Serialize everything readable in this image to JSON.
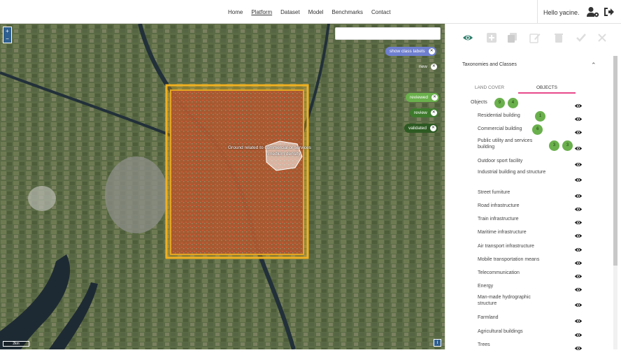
{
  "nav": {
    "links": [
      "Home",
      "Platform",
      "Dataset",
      "Model",
      "Benchmarks",
      "Contact"
    ],
    "active": "Platform",
    "greeting": "Hello yacine."
  },
  "map": {
    "zoom_in": "+",
    "zoom_out": "−",
    "search_placeholder": "",
    "filters": [
      {
        "label": "show class labels",
        "color": "#6f7fcf"
      },
      {
        "label": "new",
        "color": "#555555"
      },
      {
        "label": "reviewed",
        "color": "#6ab04c"
      },
      {
        "label": "review",
        "color": "#3d7a2c"
      },
      {
        "label": "validated",
        "color": "#2d5a22"
      }
    ],
    "annotation_line1": "Ground related to commercial or services",
    "annotation_line2": "- medium density",
    "scale": "2km",
    "info": "i"
  },
  "panel": {
    "section_title": "Taxonomies and Classes",
    "tabs": [
      "LAND COVER",
      "OBJECTS"
    ],
    "active_tab": "OBJECTS",
    "root": {
      "label": "Objects",
      "badges": [
        "9",
        "4"
      ]
    },
    "items": [
      {
        "label": "Residential building",
        "badges": [
          "1"
        ]
      },
      {
        "label": "Commercial building",
        "badges": [
          "6"
        ]
      },
      {
        "label": "Public utility and services building",
        "badges": [
          "3",
          "3"
        ]
      },
      {
        "label": "Outdoor sport facility",
        "badges": []
      },
      {
        "label": "Industrial building and structure",
        "badges": []
      },
      {
        "label": "Street furniture",
        "badges": []
      },
      {
        "label": "Road infrastructure",
        "badges": []
      },
      {
        "label": "Train infrastructure",
        "badges": []
      },
      {
        "label": "Maritime infrastructure",
        "badges": []
      },
      {
        "label": "Air transport infrastructure",
        "badges": []
      },
      {
        "label": "Mobile transportation means",
        "badges": []
      },
      {
        "label": "Telecommunication",
        "badges": []
      },
      {
        "label": "Energy",
        "badges": []
      },
      {
        "label": "Man-made hydrographic structure",
        "badges": []
      },
      {
        "label": "Farmland",
        "badges": []
      },
      {
        "label": "Agricultural buildings",
        "badges": []
      },
      {
        "label": "Trees",
        "badges": []
      }
    ]
  },
  "colors": {
    "accent": "#2e7d6b",
    "tab_underline": "#e84a8a",
    "badge": "#6ab04c"
  }
}
